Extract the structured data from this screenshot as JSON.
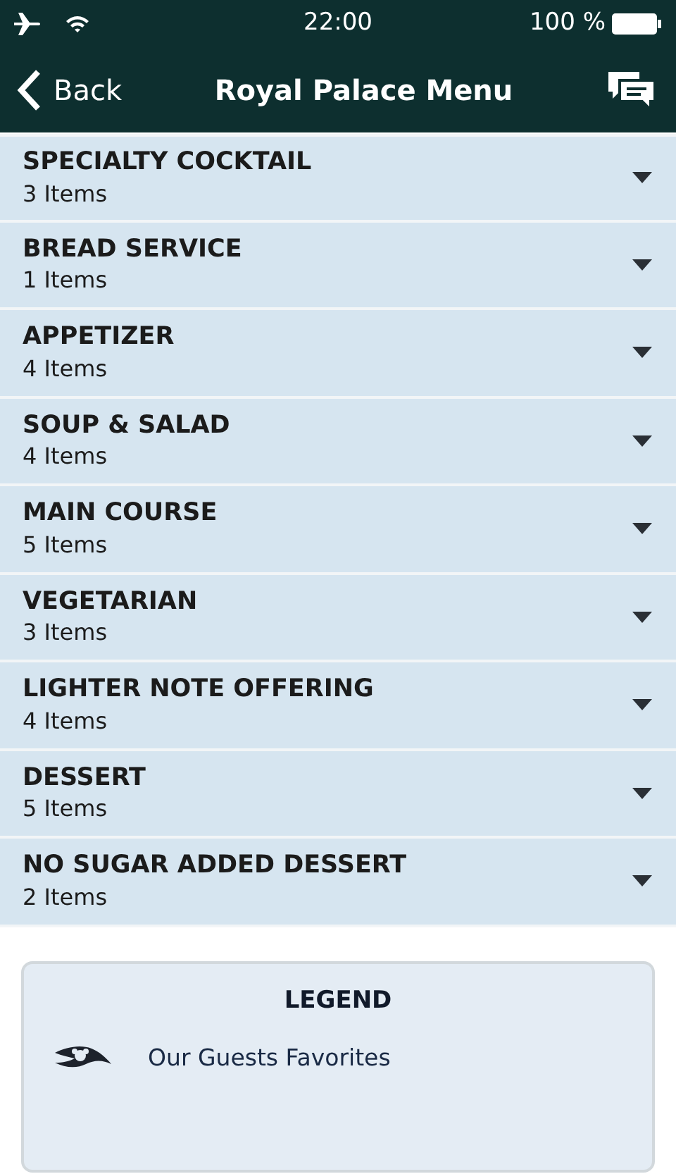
{
  "status_bar": {
    "time": "22:00",
    "battery": "100 %"
  },
  "nav_bar": {
    "back": "Back",
    "title": "Royal Palace Menu"
  },
  "sections": [
    {
      "title": "SPECIALTY COCKTAIL",
      "count": "3 Items",
      "expanded": false
    },
    {
      "title": "BREAD SERVICE",
      "count": "1 Items",
      "expanded": false
    },
    {
      "title": "APPETIZER",
      "count": "4 Items",
      "expanded": false
    },
    {
      "title": "SOUP & SALAD",
      "count": "4 Items",
      "expanded": false
    },
    {
      "title": "MAIN COURSE",
      "count": "5 Items",
      "expanded": false
    },
    {
      "title": "VEGETARIAN",
      "count": "3 Items",
      "expanded": false
    },
    {
      "title": "LIGHTER NOTE OFFERING",
      "count": "4 Items",
      "expanded": false
    },
    {
      "title": "DESSERT",
      "count": "5 Items",
      "expanded": false
    },
    {
      "title": "NO SUGAR ADDED DESSERT",
      "count": "2 Items",
      "expanded": false
    }
  ],
  "legend": {
    "title": "LEGEND",
    "items": [
      {
        "label": "Our Guests Favorites"
      }
    ]
  }
}
